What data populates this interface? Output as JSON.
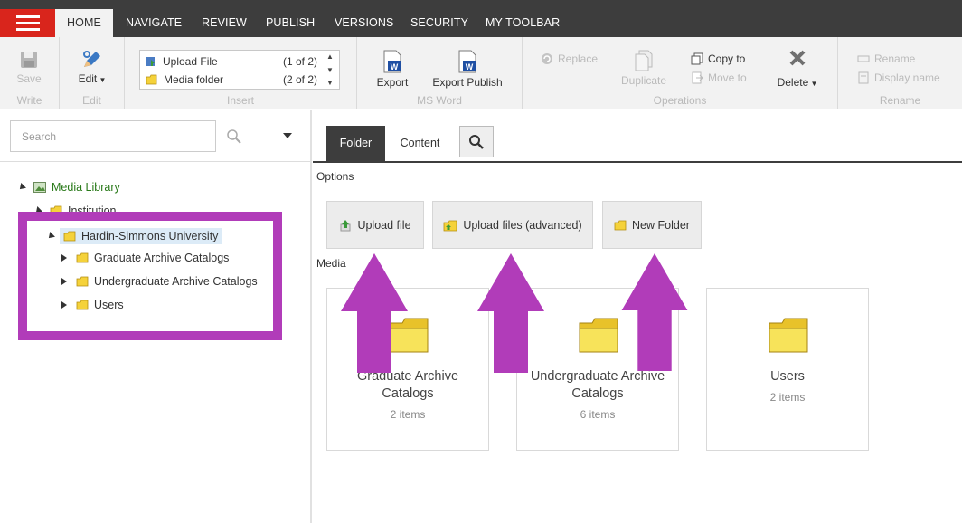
{
  "nav": {
    "tabs": [
      {
        "label": "HOME"
      },
      {
        "label": "NAVIGATE"
      },
      {
        "label": "REVIEW"
      },
      {
        "label": "PUBLISH"
      },
      {
        "label": "VERSIONS"
      },
      {
        "label": "SECURITY"
      },
      {
        "label": "MY TOOLBAR"
      }
    ]
  },
  "ribbon": {
    "write": {
      "label": "Write",
      "save": "Save"
    },
    "edit": {
      "label": "Edit",
      "edit_btn": "Edit"
    },
    "insert": {
      "label": "Insert",
      "items": [
        {
          "name": "Upload File",
          "count": "(1 of 2)"
        },
        {
          "name": "Media folder",
          "count": "(2 of 2)"
        }
      ]
    },
    "msword": {
      "label": "MS Word",
      "export": "Export",
      "export_publish": "Export Publish"
    },
    "operations": {
      "label": "Operations",
      "replace": "Replace",
      "duplicate": "Duplicate",
      "copy_to": "Copy to",
      "move_to": "Move to",
      "delete": "Delete"
    },
    "rename": {
      "label": "Rename",
      "rename": "Rename",
      "display_name": "Display name"
    }
  },
  "left": {
    "search_placeholder": "Search",
    "tree": {
      "root": "Media Library",
      "institution": "Institution",
      "university": "Hardin-Simmons University",
      "children": [
        "Graduate Archive Catalogs",
        "Undergraduate Archive Catalogs",
        "Users"
      ]
    }
  },
  "right": {
    "tabs": {
      "folder": "Folder",
      "content": "Content"
    },
    "options_label": "Options",
    "buttons": {
      "upload_file": "Upload file",
      "upload_advanced": "Upload files (advanced)",
      "new_folder": "New Folder"
    },
    "media_label": "Media",
    "cards": [
      {
        "title": "Graduate Archive Catalogs",
        "count": "2 items"
      },
      {
        "title": "Undergraduate Archive Catalogs",
        "count": "6 items"
      },
      {
        "title": "Users",
        "count": "2 items"
      }
    ]
  },
  "colors": {
    "accent_red": "#d9251c",
    "annotation_purple": "#b13cb9",
    "dark_bar": "#3d3d3d"
  }
}
